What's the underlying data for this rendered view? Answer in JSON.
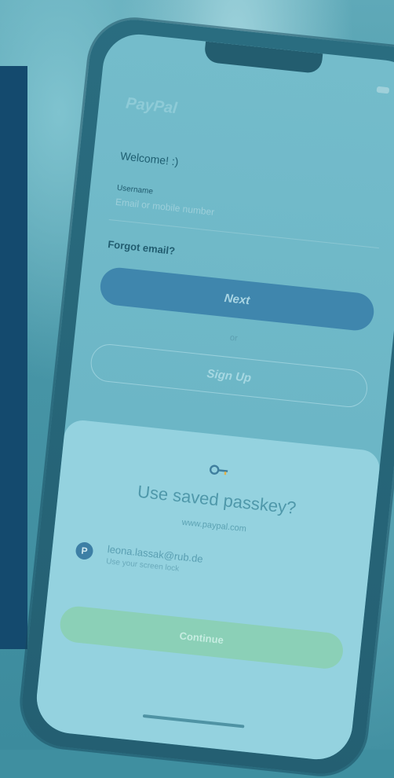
{
  "login_form": {
    "logo_text": "PayPal",
    "welcome_text": "Welcome! :)",
    "email_label": "Username",
    "email_placeholder": "Email or mobile number",
    "forgot_link": "Forgot email?",
    "next_button": "Next",
    "or_text": "or",
    "signup_button": "Sign Up"
  },
  "passkey_sheet": {
    "icon": "key-icon",
    "title": "Use saved passkey?",
    "domain": "www.paypal.com",
    "account_icon_letter": "P",
    "account_email": "leona.lassak@rub.de",
    "account_subtext": "Use your screen lock",
    "continue_button": "Continue"
  },
  "colors": {
    "left_panel": "#144a6e",
    "next_button": "#3f86ad",
    "continue_button": "#8bd0b7",
    "sheet": "#94d2df"
  }
}
